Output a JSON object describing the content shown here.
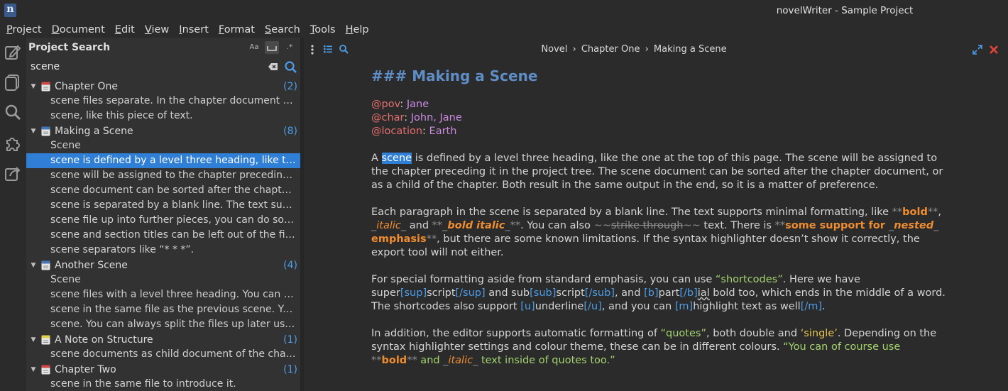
{
  "window": {
    "app_icon_letter": "n",
    "title": "novelWriter - Sample Project"
  },
  "menu": [
    {
      "mnemonic": "P",
      "rest": "roject"
    },
    {
      "mnemonic": "D",
      "rest": "ocument"
    },
    {
      "mnemonic": "E",
      "rest": "dit"
    },
    {
      "mnemonic": "V",
      "rest": "iew"
    },
    {
      "mnemonic": "I",
      "rest": "nsert"
    },
    {
      "mnemonic": "F",
      "rest": "ormat"
    },
    {
      "mnemonic": "S",
      "rest": "earch"
    },
    {
      "mnemonic": "T",
      "rest": "ools"
    },
    {
      "mnemonic": "H",
      "rest": "elp"
    }
  ],
  "sidebar_icons": [
    "edit-project-icon",
    "novel-view-icon",
    "search-icon",
    "plugin-icon",
    "export-icon"
  ],
  "search": {
    "title": "Project Search",
    "option_case": "Aa",
    "option_regex": ".*",
    "query": "scene",
    "results": [
      {
        "title": "Chapter One",
        "count": "(2)",
        "doc_color": "#d04848",
        "lines": [
          "scene files separate. In the chapter document we …",
          "scene, like this piece of text."
        ]
      },
      {
        "title": "Making a Scene",
        "count": "(8)",
        "doc_color": "#4a74b8",
        "lines": [
          "Scene",
          "scene is defined by a level three heading, like the …",
          "scene will be assigned to the chapter preceding it …",
          "scene document can be sorted after the chapter d…",
          "scene is separated by a blank line. The text suppor…",
          "scene file up into further pieces, you can do so wit…",
          "scene and section titles can be left out of the final …",
          "scene separators like “* * *”."
        ]
      },
      {
        "title": "Another Scene",
        "count": "(4)",
        "doc_color": "#4a74b8",
        "lines": [
          "Scene",
          "scene files with a level three heading. You can of c…",
          "scene in the same file as the previous scene. You c…",
          "scene. You can always split the files up later using …"
        ]
      },
      {
        "title": "A Note on Structure",
        "count": "(1)",
        "doc_color": "#e0d24a",
        "lines": [
          "scene documents as child document of the chapte…"
        ]
      },
      {
        "title": "Chapter Two",
        "count": "(1)",
        "doc_color": "#d04848",
        "lines": [
          "scene in the same file to introduce it."
        ]
      }
    ]
  },
  "editor": {
    "breadcrumb": [
      "Novel",
      "›",
      "Chapter One",
      "›",
      "Making a Scene"
    ],
    "heading": "### Making a Scene",
    "meta": [
      {
        "key": "@pov",
        "sep": ": ",
        "value": "Jane"
      },
      {
        "key": "@char",
        "sep": ": ",
        "value": "John, Jane"
      },
      {
        "key": "@location",
        "sep": ": ",
        "value": "Earth"
      }
    ],
    "p1": {
      "a": "A ",
      "hl": "scene",
      "b": " is defined by a level three heading, like the one at the top of this page. The scene will be assigned to the chapter preceding it in the project tree. The scene document can be sorted after the chapter document, or as a child of the chapter. Both result in the same output in the end, so it is a matter of preference."
    },
    "p2": {
      "t1": "Each paragraph in the scene is separated by a blank line. The text supports minimal formatting, like ",
      "m1": "**",
      "bold": "bold",
      "m2": "**",
      "t2": ", ",
      "m3": "_",
      "italic": "italic",
      "m4": "_",
      "t3": " and ",
      "m5": "**_",
      "bolditalic": "bold italic",
      "m6": "_**",
      "t4": ". You can also ",
      "m7": "~~",
      "strike": "strike through",
      "m8": "~~",
      "t5": " text. There is ",
      "m9": "**",
      "nested_a": "some support for ",
      "m10": "_",
      "nested_b": "nested",
      "m11": "_",
      "nested_c": "emphasis",
      "m12": "**",
      "t6": ", but there are some known limitations. If the syntax highlighter doesn’t show it correctly, the export tool will not either."
    },
    "p3": {
      "t1": "For special formatting aside from standard emphasis, you can use ",
      "q1": "“shortcodes”",
      "t2": ". Here we have super",
      "sc1": "[sup]",
      "t3": "script",
      "sc2": "[/sup]",
      "t4": " and sub",
      "sc3": "[sub]",
      "t5": "script",
      "sc4": "[/sub]",
      "t6": ", and ",
      "sc5": "[b]",
      "t7": "part",
      "sc6": "[/b]",
      "t8": "ial",
      "t9": " bold too, which ends in the middle of a word. The shortcodes also support ",
      "sc7": "[u]",
      "t10": "underline",
      "sc8": "[/u]",
      "t11": ", and you can ",
      "sc9": "[m]",
      "t12": "highlight text as well",
      "sc10": "[/m]",
      "t13": "."
    },
    "p4": {
      "t1": "In addition, the editor supports automatic formatting of ",
      "q1": "“quotes”",
      "t2": ", both double and ",
      "q2": "‘single’",
      "t3": ". Depending on the syntax highlighter settings and colour theme, these can be in different colours. ",
      "q3a": "“You can of course use ",
      "m1": "**",
      "bold": "bold",
      "m2": "**",
      "q3b": " and ",
      "m3": "_",
      "italic": "italic",
      "m4": "_",
      "q3c": " text inside of quotes too.”"
    }
  }
}
